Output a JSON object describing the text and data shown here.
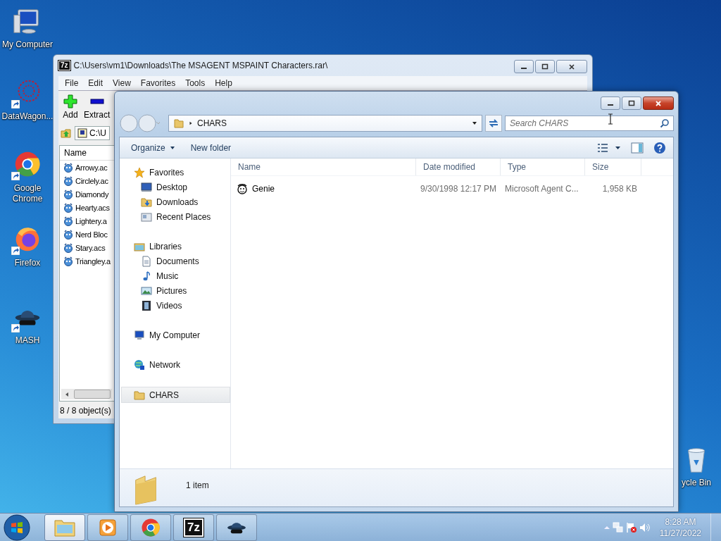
{
  "desktop_icons": [
    {
      "label": "My Computer",
      "kind": "computer",
      "shortcut": false
    },
    {
      "label": "DataWagon...",
      "kind": "datawagon",
      "shortcut": true
    },
    {
      "label": "Google Chrome",
      "kind": "chrome",
      "shortcut": true
    },
    {
      "label": "Firefox",
      "kind": "firefox",
      "shortcut": true
    },
    {
      "label": "MASH",
      "kind": "mash",
      "shortcut": true
    },
    {
      "label": "ycle Bin",
      "kind": "recycle",
      "shortcut": false
    }
  ],
  "archive_window": {
    "icon_label": "7z",
    "title": "C:\\Users\\vm1\\Downloads\\The MSAGENT MSPAINT Characters.rar\\",
    "menu": [
      "File",
      "Edit",
      "View",
      "Favorites",
      "Tools",
      "Help"
    ],
    "toolbar": [
      {
        "label": "Add",
        "kind": "add"
      },
      {
        "label": "Extract",
        "kind": "extract"
      }
    ],
    "path": "C:\\U",
    "columns": [
      "Name"
    ],
    "files": [
      "Arrowy.ac",
      "Circlely.ac",
      "Diamondy",
      "Hearty.acs",
      "Lightery.a",
      "Nerd Bloc",
      "Stary.acs",
      "Triangley.a"
    ],
    "status": "8 / 8 object(s)"
  },
  "explorer_window": {
    "address": "CHARS",
    "search": {
      "placeholder": "Search CHARS"
    },
    "toolbar": [
      {
        "label": "Organize",
        "dropdown": true
      },
      {
        "label": "New folder",
        "dropdown": false
      }
    ],
    "nav": [
      {
        "label": "Favorites",
        "kind": "star",
        "selected": false,
        "children": [
          {
            "label": "Desktop",
            "kind": "desktop",
            "selected": false
          },
          {
            "label": "Downloads",
            "kind": "downloads",
            "selected": false
          },
          {
            "label": "Recent Places",
            "kind": "recent",
            "selected": false
          }
        ]
      },
      {
        "label": "Libraries",
        "kind": "libraries",
        "selected": false,
        "children": [
          {
            "label": "Documents",
            "kind": "document",
            "selected": false
          },
          {
            "label": "Music",
            "kind": "music",
            "selected": false
          },
          {
            "label": "Pictures",
            "kind": "pictures",
            "selected": false
          },
          {
            "label": "Videos",
            "kind": "videos",
            "selected": false
          }
        ]
      },
      {
        "label": "My Computer",
        "kind": "computer",
        "selected": false
      },
      {
        "label": "Network",
        "kind": "network",
        "selected": false
      },
      {
        "label": "CHARS",
        "kind": "folder",
        "selected": true
      }
    ],
    "columns": [
      "Name",
      "Date modified",
      "Type",
      "Size"
    ],
    "rows": [
      {
        "name": "Genie",
        "date": "9/30/1998 12:17 PM",
        "type": "Microsoft Agent C...",
        "size": "1,958 KB"
      }
    ],
    "details": "1 item"
  },
  "taskbar": {
    "buttons": [
      {
        "kind": "explorer",
        "active": true
      },
      {
        "kind": "media",
        "active": false
      },
      {
        "kind": "chrome",
        "active": false
      },
      {
        "kind": "archiver",
        "active": false,
        "label": "7z"
      },
      {
        "kind": "mash",
        "active": false
      }
    ],
    "clock": {
      "time": "8:28 AM",
      "date": "11/27/2022"
    }
  }
}
